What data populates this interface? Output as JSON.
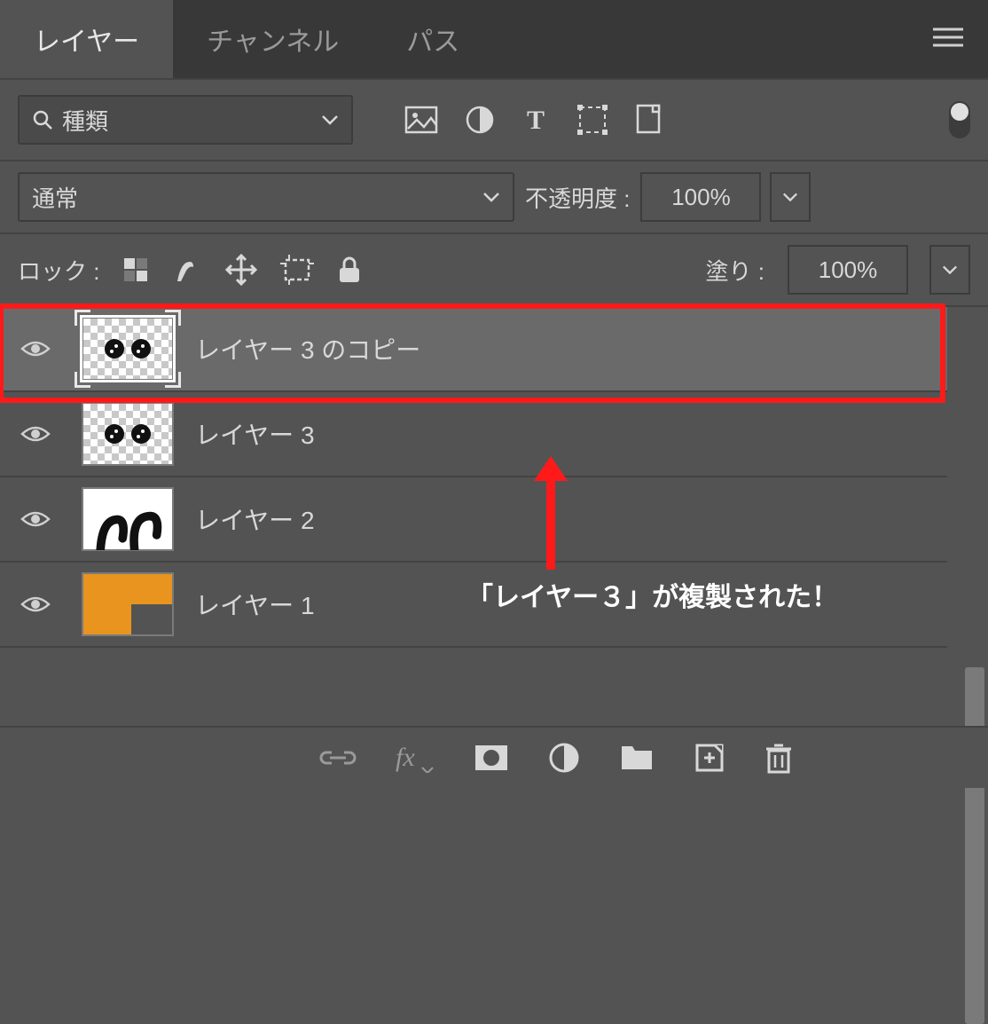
{
  "tabs": {
    "layers": "レイヤー",
    "channels": "チャンネル",
    "paths": "パス"
  },
  "filter": {
    "kind_label": "種類"
  },
  "blend": {
    "mode": "通常",
    "opacity_label": "不透明度 : ",
    "opacity_value": "100%"
  },
  "lock": {
    "label": "ロック : ",
    "fill_label": "塗り : ",
    "fill_value": "100%"
  },
  "layers_list": [
    {
      "name": "レイヤー 3 のコピー",
      "selected": true
    },
    {
      "name": "レイヤー 3",
      "selected": false
    },
    {
      "name": "レイヤー 2",
      "selected": false
    },
    {
      "name": "レイヤー 1",
      "selected": false
    }
  ],
  "annotation": {
    "text": "「レイヤー３」が複製された！"
  }
}
